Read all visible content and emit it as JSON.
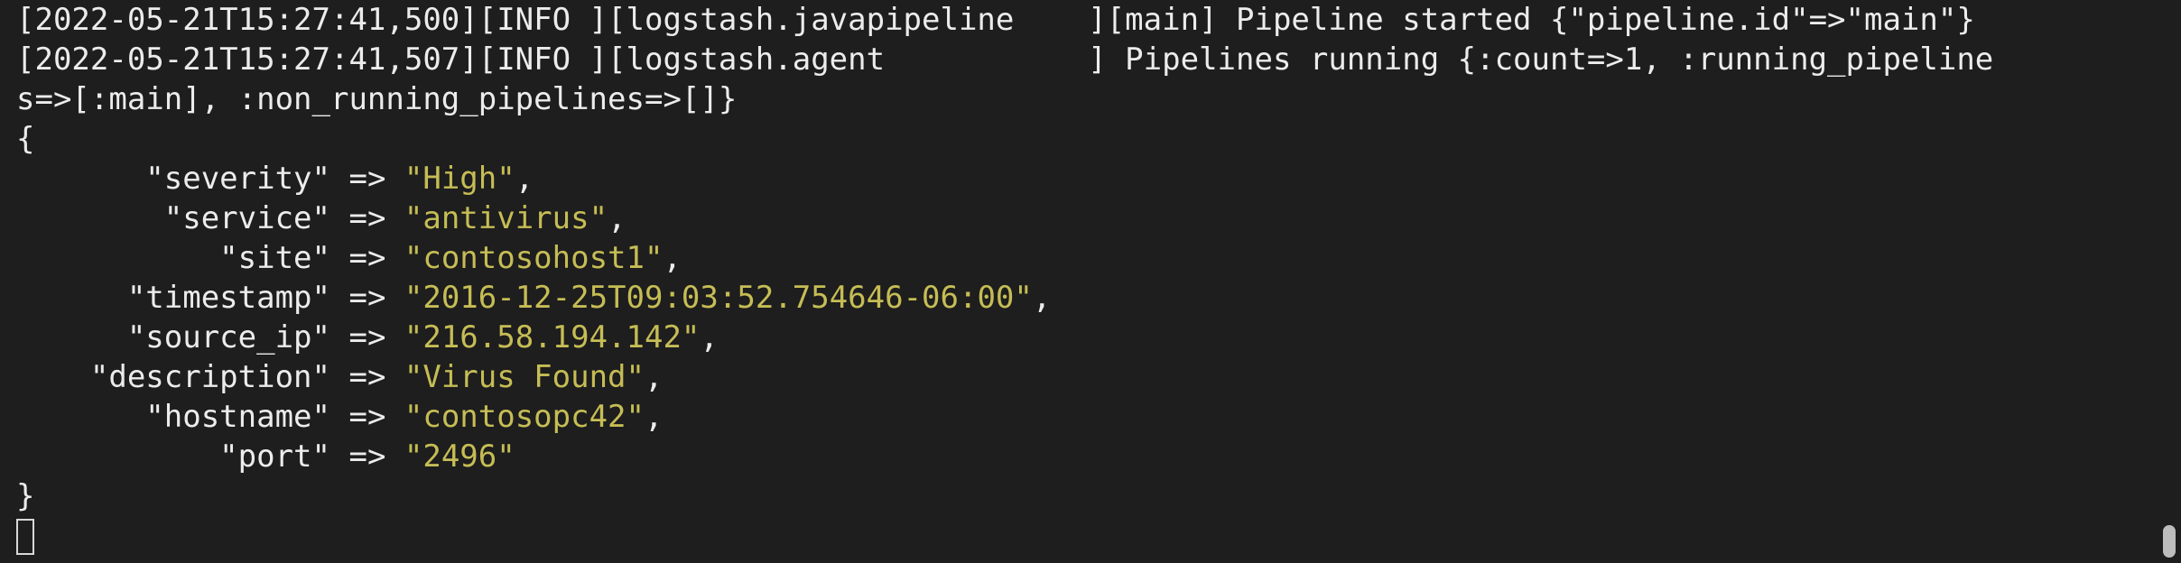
{
  "terminal": {
    "log_lines": [
      "[2022-05-21T15:27:41,500][INFO ][logstash.javapipeline    ][main] Pipeline started {\"pipeline.id\"=>\"main\"}",
      "[2022-05-21T15:27:41,507][INFO ][logstash.agent           ] Pipelines running {:count=>1, :running_pipeline",
      "s=>[:main], :non_running_pipelines=>[]}"
    ],
    "open_brace": "{",
    "close_brace": "}",
    "fields": [
      {
        "indent": "       ",
        "key": "\"severity\"",
        "arrow": " => ",
        "value": "\"High\"",
        "sep": ","
      },
      {
        "indent": "        ",
        "key": "\"service\"",
        "arrow": " => ",
        "value": "\"antivirus\"",
        "sep": ","
      },
      {
        "indent": "           ",
        "key": "\"site\"",
        "arrow": " => ",
        "value": "\"contosohost1\"",
        "sep": ","
      },
      {
        "indent": "      ",
        "key": "\"timestamp\"",
        "arrow": " => ",
        "value": "\"2016-12-25T09:03:52.754646-06:00\"",
        "sep": ","
      },
      {
        "indent": "      ",
        "key": "\"source_ip\"",
        "arrow": " => ",
        "value": "\"216.58.194.142\"",
        "sep": ","
      },
      {
        "indent": "    ",
        "key": "\"description\"",
        "arrow": " => ",
        "value": "\"Virus Found\"",
        "sep": ","
      },
      {
        "indent": "       ",
        "key": "\"hostname\"",
        "arrow": " => ",
        "value": "\"contosopc42\"",
        "sep": ","
      },
      {
        "indent": "           ",
        "key": "\"port\"",
        "arrow": " => ",
        "value": "\"2496\"",
        "sep": ""
      }
    ],
    "colors": {
      "background": "#1e1e1e",
      "text": "#ececec",
      "string_value": "#c6bd55"
    }
  }
}
